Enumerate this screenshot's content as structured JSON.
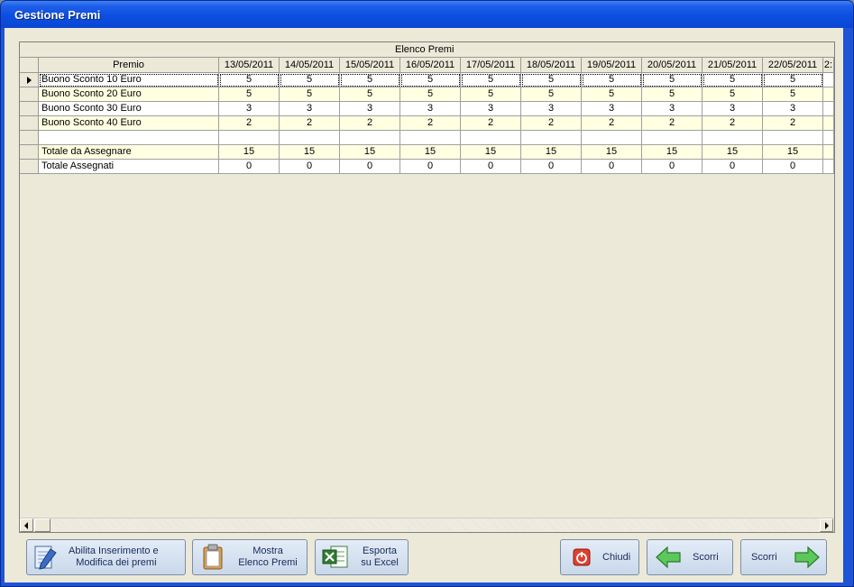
{
  "window": {
    "title": "Gestione Premi"
  },
  "grid": {
    "caption": "Elenco Premi",
    "columns": [
      "Premio",
      "13/05/2011",
      "14/05/2011",
      "15/05/2011",
      "16/05/2011",
      "17/05/2011",
      "18/05/2011",
      "19/05/2011",
      "20/05/2011",
      "21/05/2011",
      "22/05/2011",
      "2:"
    ],
    "rows": [
      {
        "label": "Buono Sconto 10 Euro",
        "values": [
          "5",
          "5",
          "5",
          "5",
          "5",
          "5",
          "5",
          "5",
          "5",
          "5"
        ]
      },
      {
        "label": "Buono Sconto 20 Euro",
        "values": [
          "5",
          "5",
          "5",
          "5",
          "5",
          "5",
          "5",
          "5",
          "5",
          "5"
        ]
      },
      {
        "label": "Buono Sconto 30 Euro",
        "values": [
          "3",
          "3",
          "3",
          "3",
          "3",
          "3",
          "3",
          "3",
          "3",
          "3"
        ]
      },
      {
        "label": "Buono Sconto 40 Euro",
        "values": [
          "2",
          "2",
          "2",
          "2",
          "2",
          "2",
          "2",
          "2",
          "2",
          "2"
        ]
      },
      {
        "label": "",
        "values": [
          "",
          "",
          "",
          "",
          "",
          "",
          "",
          "",
          "",
          ""
        ]
      },
      {
        "label": "Totale da Assegnare",
        "values": [
          "15",
          "15",
          "15",
          "15",
          "15",
          "15",
          "15",
          "15",
          "15",
          "15"
        ]
      },
      {
        "label": "Totale Assegnati",
        "values": [
          "0",
          "0",
          "0",
          "0",
          "0",
          "0",
          "0",
          "0",
          "0",
          "0"
        ]
      }
    ]
  },
  "buttons": {
    "abilita": "Abilita Inserimento e\n  Modifica dei premi",
    "mostra": "Mostra\nElenco Premi",
    "esporta": "Esporta\nsu Excel",
    "chiudi": "Chiudi",
    "scorri_back": "Scorri",
    "scorri_forward": "Scorri"
  },
  "colors": {
    "row_yellow": "#ffffe1",
    "row_white": "#ffffff",
    "titlebar": "#0b4fe0"
  }
}
